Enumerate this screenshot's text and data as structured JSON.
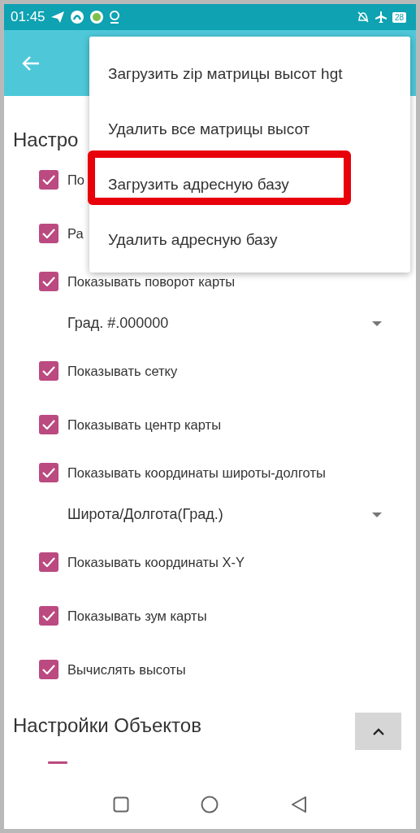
{
  "status_bar": {
    "time": "01:45",
    "battery": "28"
  },
  "menu": {
    "items": [
      {
        "label": "Загрузить zip матрицы высот hgt",
        "highlighted": false
      },
      {
        "label": "Удалить все матрицы высот",
        "highlighted": false
      },
      {
        "label": "Загрузить адресную базу",
        "highlighted": true
      },
      {
        "label": "Удалить адресную базу",
        "highlighted": false
      }
    ]
  },
  "section_title": "Настро",
  "settings": [
    {
      "kind": "checkbox",
      "label": "По",
      "checked": true
    },
    {
      "kind": "checkbox",
      "label": "Ра",
      "checked": true
    },
    {
      "kind": "checkbox",
      "label": "Показывать поворот карты",
      "checked": true
    },
    {
      "kind": "dropdown",
      "value": "Град. #.000000"
    },
    {
      "kind": "checkbox",
      "label": "Показывать сетку",
      "checked": true
    },
    {
      "kind": "checkbox",
      "label": "Показывать центр карты",
      "checked": true
    },
    {
      "kind": "checkbox",
      "label": "Показывать координаты широты-долготы",
      "checked": true
    },
    {
      "kind": "dropdown",
      "value": "Широта/Долгота(Град.)"
    },
    {
      "kind": "checkbox",
      "label": "Показывать координаты X-Y",
      "checked": true
    },
    {
      "kind": "checkbox",
      "label": "Показывать зум карты",
      "checked": true
    },
    {
      "kind": "checkbox",
      "label": "Вычислять высоты",
      "checked": true
    }
  ],
  "section2": {
    "title": "Настройки Объектов"
  }
}
